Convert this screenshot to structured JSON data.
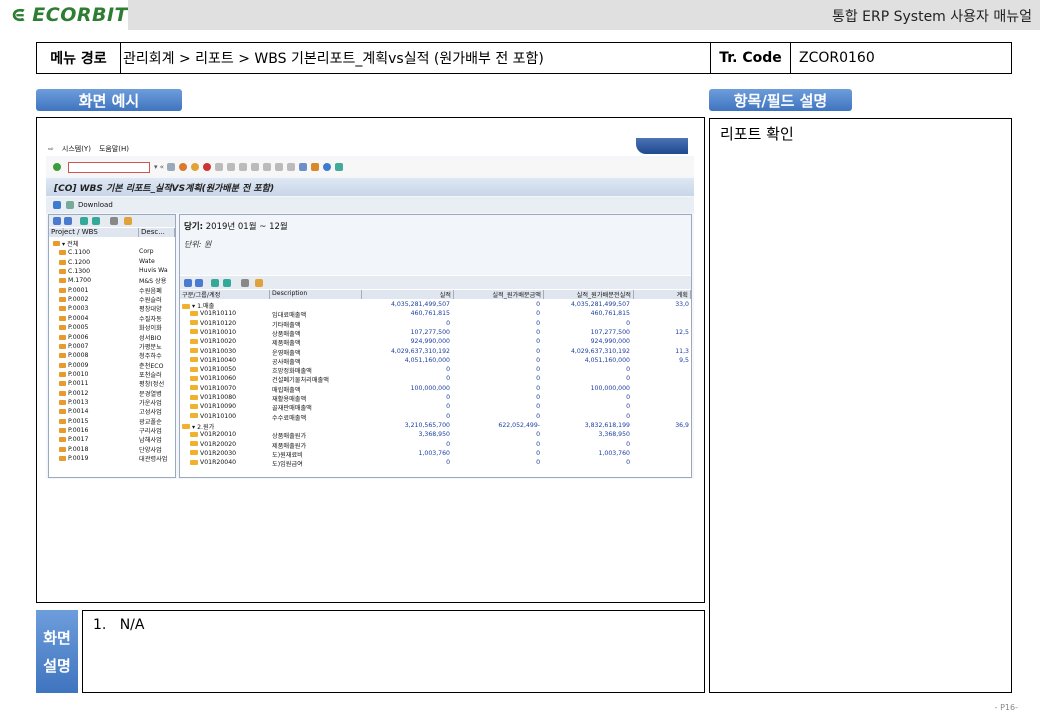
{
  "header": {
    "logo": "ECORBIT",
    "title": "통합 ERP System 사용자 매뉴얼"
  },
  "info": {
    "menu_path_label": "메뉴 경로",
    "menu_path": "관리회계 > 리포트 > WBS 기본리포트_계획vs실적 (원가배부 전 포함)",
    "tr_code_label": "Tr. Code",
    "tr_code": "ZCOR0160"
  },
  "sections": {
    "screen_example": "화면 예시",
    "field_desc": "항목/필드 설명",
    "field_desc_text": "리포트 확인",
    "screen_desc_label_1": "화면",
    "screen_desc_label_2": "설명",
    "screen_desc_text": "1.   N/A"
  },
  "page_number": "- P16-",
  "sap": {
    "menu": [
      "시스템(Y)",
      "도움말(H)"
    ],
    "title": "[CO] WBS 기본 리포트_실적VS계획(원가배분 전 포함)",
    "download": "Download",
    "tree_headers": [
      "Project / WBS",
      "Desc..."
    ],
    "tree_rows": [
      {
        "id": "▾ 전체",
        "desc": ""
      },
      {
        "id": "C.1100",
        "desc": "Corp"
      },
      {
        "id": "C.1200",
        "desc": "Wate"
      },
      {
        "id": "C.1300",
        "desc": "Huvis Wa"
      },
      {
        "id": "M.1700",
        "desc": "M&S 상용"
      },
      {
        "id": "P.0001",
        "desc": "수원음폐"
      },
      {
        "id": "P.0002",
        "desc": "수원슬러"
      },
      {
        "id": "P.0003",
        "desc": "평창대양"
      },
      {
        "id": "P.0004",
        "desc": "수질자동"
      },
      {
        "id": "P.0005",
        "desc": "화성이화"
      },
      {
        "id": "P.0006",
        "desc": "성서BIO"
      },
      {
        "id": "P.0007",
        "desc": "가평분뇨"
      },
      {
        "id": "P.0008",
        "desc": "청주하수"
      },
      {
        "id": "P.0009",
        "desc": "춘천ECO"
      },
      {
        "id": "P.0010",
        "desc": "포천슬러"
      },
      {
        "id": "P.0011",
        "desc": "평창(정선"
      },
      {
        "id": "P.0012",
        "desc": "문경열병"
      },
      {
        "id": "P.0013",
        "desc": "가운사업"
      },
      {
        "id": "P.0014",
        "desc": "고성사업"
      },
      {
        "id": "P.0015",
        "desc": "광교폴순"
      },
      {
        "id": "P.0016",
        "desc": "구리사업"
      },
      {
        "id": "P.0017",
        "desc": "남해사업"
      },
      {
        "id": "P.0018",
        "desc": "단양사업"
      },
      {
        "id": "P.0019",
        "desc": "대관령사업"
      }
    ],
    "period_label": "당기:",
    "period": "2019년 01월 ~ 12월",
    "unit": "단위: 원",
    "grid_headers": [
      "구분/그룹/계정",
      "Description",
      "실적",
      "실적_원가배분금액",
      "실적_원가배분전실적",
      "계획"
    ],
    "grid_rows": [
      {
        "acct": "▾ 1.매출",
        "desc": "",
        "actual": "4,035,281,499,507",
        "alloc": "0",
        "pre": "4,035,281,499,507",
        "plan": "33,0",
        "level": 0
      },
      {
        "acct": "V01R10110",
        "desc": "임대료매출액",
        "actual": "460,761,815",
        "alloc": "0",
        "pre": "460,761,815",
        "plan": "",
        "level": 1
      },
      {
        "acct": "V01R10120",
        "desc": "기타매출액",
        "actual": "0",
        "alloc": "0",
        "pre": "0",
        "plan": "",
        "level": 1
      },
      {
        "acct": "V01R10010",
        "desc": "상품매출액",
        "actual": "107,277,500",
        "alloc": "0",
        "pre": "107,277,500",
        "plan": "12,5",
        "level": 1
      },
      {
        "acct": "V01R10020",
        "desc": "제품매출액",
        "actual": "924,990,000",
        "alloc": "0",
        "pre": "924,990,000",
        "plan": "",
        "level": 1
      },
      {
        "acct": "V01R10030",
        "desc": "운영매출액",
        "actual": "4,029,637,310,192",
        "alloc": "0",
        "pre": "4,029,637,310,192",
        "plan": "11,3",
        "level": 1
      },
      {
        "acct": "V01R10040",
        "desc": "공사매출액",
        "actual": "4,051,160,000",
        "alloc": "0",
        "pre": "4,051,160,000",
        "plan": "9,5",
        "level": 1
      },
      {
        "acct": "V01R10050",
        "desc": "흐망정화매출액",
        "actual": "0",
        "alloc": "0",
        "pre": "0",
        "plan": "",
        "level": 1
      },
      {
        "acct": "V01R10060",
        "desc": "건설폐기물처리매출액",
        "actual": "0",
        "alloc": "0",
        "pre": "0",
        "plan": "",
        "level": 1
      },
      {
        "acct": "V01R10070",
        "desc": "매립매출액",
        "actual": "100,000,000",
        "alloc": "0",
        "pre": "100,000,000",
        "plan": "",
        "level": 1
      },
      {
        "acct": "V01R10080",
        "desc": "재활용매출액",
        "actual": "0",
        "alloc": "0",
        "pre": "0",
        "plan": "",
        "level": 1
      },
      {
        "acct": "V01R10090",
        "desc": "골재판매매출액",
        "actual": "0",
        "alloc": "0",
        "pre": "0",
        "plan": "",
        "level": 1
      },
      {
        "acct": "V01R10100",
        "desc": "수수료매출액",
        "actual": "0",
        "alloc": "0",
        "pre": "0",
        "plan": "",
        "level": 1
      },
      {
        "acct": "▾ 2.원가",
        "desc": "",
        "actual": "3,210,565,700",
        "alloc": "622,052,499-",
        "pre": "3,832,618,199",
        "plan": "36,9",
        "level": 0
      },
      {
        "acct": "V01R20010",
        "desc": "상품매출원가",
        "actual": "3,368,950",
        "alloc": "0",
        "pre": "3,368,950",
        "plan": "",
        "level": 1
      },
      {
        "acct": "V01R20020",
        "desc": "제품매출원가",
        "actual": "0",
        "alloc": "0",
        "pre": "0",
        "plan": "",
        "level": 1
      },
      {
        "acct": "V01R20030",
        "desc": "도)원재료비",
        "actual": "1,003,760",
        "alloc": "0",
        "pre": "1,003,760",
        "plan": "",
        "level": 1
      },
      {
        "acct": "V01R20040",
        "desc": "도)임원급여",
        "actual": "0",
        "alloc": "0",
        "pre": "0",
        "plan": "",
        "level": 1
      }
    ]
  }
}
